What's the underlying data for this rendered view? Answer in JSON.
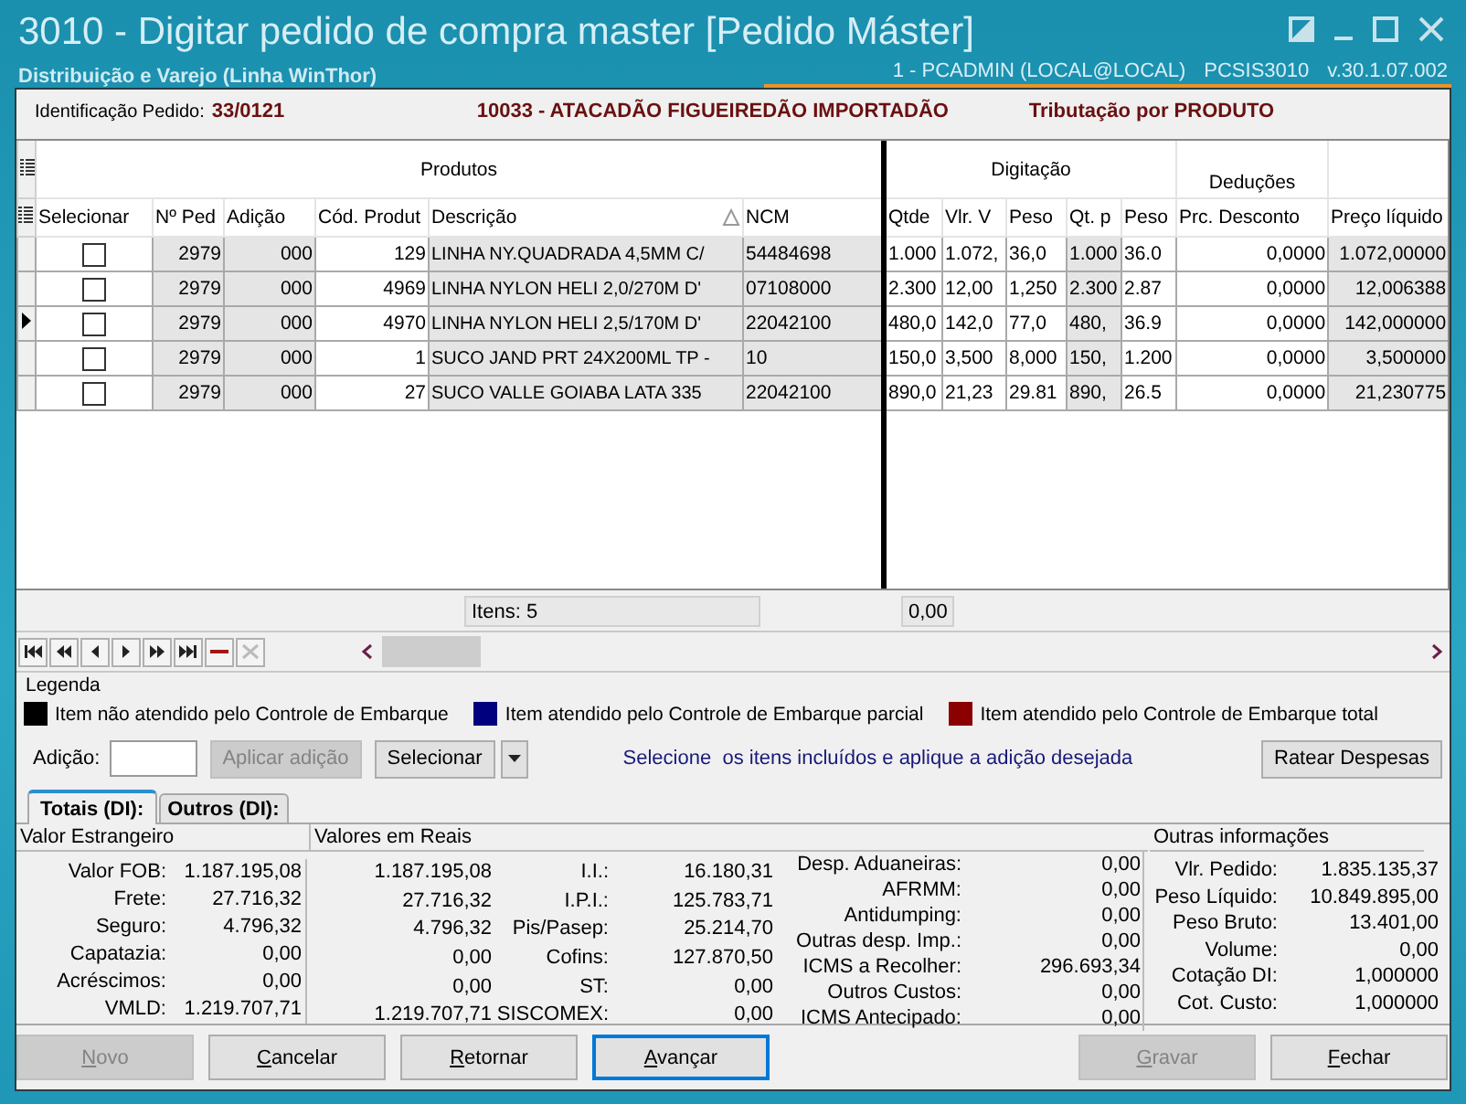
{
  "window": {
    "title": "3010 - Digitar pedido de compra master [Pedido Máster]",
    "subtitle": "Distribuição e Varejo (Linha WinThor)",
    "user": "1 - PCADMIN (LOCAL@LOCAL)",
    "program": "PCSIS3010",
    "version": "v.30.1.07.002"
  },
  "header": {
    "id_label": "Identificação Pedido:",
    "id_value": "33/0121",
    "supplier": "10033 - ATACADÃO FIGUEIREDÃO IMPORTADÃO",
    "taxation": "Tributação por PRODUTO"
  },
  "grid": {
    "groups": [
      {
        "label": "Produtos",
        "columns": [
          {
            "label": "Selecionar",
            "kind": "check",
            "shaded": false
          },
          {
            "label": "Nº Ped",
            "kind": "number",
            "shaded": true
          },
          {
            "label": "Adição",
            "kind": "number",
            "shaded": true
          },
          {
            "label": "Cód. Produt",
            "kind": "number",
            "shaded": false
          },
          {
            "label": "Descrição",
            "kind": "text",
            "shaded": true,
            "sorted": true
          },
          {
            "label": "NCM",
            "kind": "text",
            "shaded": true
          }
        ]
      },
      {
        "label": "Digitação",
        "columns": [
          {
            "label": "Qtde",
            "kind": "text",
            "shaded": false
          },
          {
            "label": "Vlr. V",
            "kind": "text",
            "shaded": false
          },
          {
            "label": "Peso",
            "kind": "text",
            "shaded": false
          },
          {
            "label": "Qt. p",
            "kind": "text",
            "shaded": true
          },
          {
            "label": "Peso",
            "kind": "text",
            "shaded": false
          }
        ]
      },
      {
        "label": "Deduções",
        "columns": [
          {
            "label": "Prc. Desconto",
            "kind": "number",
            "shaded": false
          }
        ]
      },
      {
        "columns": [
          {
            "label": "Preço líquido",
            "kind": "number",
            "shaded": true
          }
        ]
      }
    ],
    "rows": [
      {
        "selected": false,
        "checked": false,
        "cells": [
          "2979",
          "000",
          "129",
          "LINHA NY.QUADRADA 4,5MM C/",
          "54484698",
          "1.000",
          "1.072,",
          "36,0",
          "1.000",
          "36.0",
          "0,0000",
          "1.072,00000"
        ]
      },
      {
        "selected": false,
        "checked": false,
        "cells": [
          "2979",
          "000",
          "4969",
          "LINHA NYLON HELI 2,0/270M D'",
          "07108000",
          "2.300",
          "12,00",
          "1,250",
          "2.300",
          "2.87",
          "0,0000",
          "12,006388"
        ]
      },
      {
        "selected": true,
        "checked": false,
        "cells": [
          "2979",
          "000",
          "4970",
          "LINHA NYLON HELI 2,5/170M D'",
          "22042100",
          "480,0",
          "142,0",
          "77,0",
          "480,",
          "36.9",
          "0,0000",
          "142,000000"
        ]
      },
      {
        "selected": false,
        "checked": false,
        "cells": [
          "2979",
          "000",
          "1",
          "SUCO JAND PRT 24X200ML TP -",
          "10",
          "150,0",
          "3,500",
          "8,000",
          "150,",
          "1.200",
          "0,0000",
          "3,500000"
        ]
      },
      {
        "selected": false,
        "checked": false,
        "cells": [
          "2979",
          "000",
          "27",
          "SUCO VALLE GOIABA LATA 335",
          "22042100",
          "890,0",
          "21,23",
          "29.81",
          "890,",
          "26.5",
          "0,0000",
          "21,230775"
        ]
      }
    ],
    "footer": {
      "items": "Itens: 5",
      "total": "0,00"
    }
  },
  "legend": {
    "title": "Legenda",
    "items": [
      {
        "label": "Item não atendido pelo Controle de Embarque",
        "color": "#000000"
      },
      {
        "label": "Item atendido pelo Controle de Embarque parcial",
        "color": "#00007f"
      },
      {
        "label": "Item atendido pelo Controle de Embarque total",
        "color": "#8b0000"
      }
    ]
  },
  "addition": {
    "label": "Adição:",
    "apply_button": {
      "label": "Aplicar adição",
      "disabled": true
    },
    "select_button": "Selecionar",
    "hint": "Selecione  os itens incluídos e aplique a adição desejada",
    "split_button": "Ratear Despesas"
  },
  "tabs": [
    {
      "label": "Totais (DI):",
      "selected": true
    },
    {
      "label": "Outros (DI):",
      "selected": false
    }
  ],
  "foreign": {
    "title": "Valor Estrangeiro",
    "rows": [
      {
        "label": "Valor FOB:",
        "value": "1.187.195,08"
      },
      {
        "label": "Frete:",
        "value": "27.716,32"
      },
      {
        "label": "Seguro:",
        "value": "4.796,32"
      },
      {
        "label": "Capatazia:",
        "value": "0,00"
      },
      {
        "label": "Acréscimos:",
        "value": "0,00"
      },
      {
        "label": "VMLD:",
        "value": "1.219.707,71"
      }
    ]
  },
  "reais": {
    "title": "Valores em Reais",
    "values": [
      "1.187.195,08",
      "27.716,32",
      "4.796,32",
      "0,00",
      "0,00",
      "1.219.707,71"
    ],
    "taxes": [
      {
        "label": "I.I.:",
        "value": "16.180,31"
      },
      {
        "label": "I.P.I.:",
        "value": "125.783,71"
      },
      {
        "label": "Pis/Pasep:",
        "value": "25.214,70"
      },
      {
        "label": "Cofins:",
        "value": "127.870,50"
      },
      {
        "label": "ST:",
        "value": "0,00"
      },
      {
        "label": "SISCOMEX:",
        "value": "0,00"
      }
    ],
    "expenses": [
      {
        "label": "Desp. Aduaneiras:",
        "value": "0,00"
      },
      {
        "label": "AFRMM:",
        "value": "0,00"
      },
      {
        "label": "Antidumping:",
        "value": "0,00"
      },
      {
        "label": "Outras desp. Imp.:",
        "value": "0,00"
      },
      {
        "label": "ICMS a Recolher:",
        "value": "296.693,34"
      },
      {
        "label": "Outros Custos:",
        "value": "0,00"
      },
      {
        "label": "ICMS Antecipado:",
        "value": "0,00"
      }
    ]
  },
  "other": {
    "title": "Outras informações",
    "rows": [
      {
        "label": "Vlr. Pedido:",
        "value": "1.835.135,37"
      },
      {
        "label": "Peso Líquido:",
        "value": "10.849.895,00"
      },
      {
        "label": "Peso Bruto:",
        "value": "13.401,00"
      },
      {
        "label": "Volume:",
        "value": "0,00"
      },
      {
        "label": "Cotação DI:",
        "value": "1,000000"
      },
      {
        "label": "Cot. Custo:",
        "value": "1,000000"
      }
    ]
  },
  "buttons": {
    "left": [
      {
        "label": "Novo",
        "disabled": true,
        "default": false
      },
      {
        "label": "Cancelar",
        "disabled": false,
        "default": false
      },
      {
        "label": "Retornar",
        "disabled": false,
        "default": false
      },
      {
        "label": "Avançar",
        "disabled": false,
        "default": true
      }
    ],
    "right": [
      {
        "label": "Gravar",
        "disabled": true,
        "default": false
      },
      {
        "label": "Fechar",
        "disabled": false,
        "default": false
      }
    ]
  }
}
